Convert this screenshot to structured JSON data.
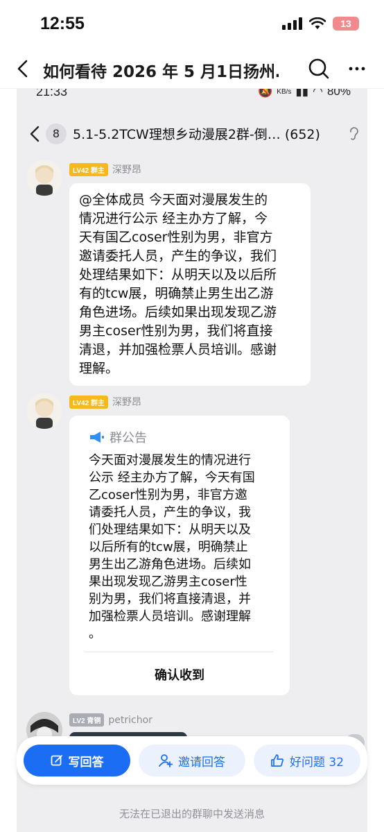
{
  "status_bar": {
    "time": "12:55",
    "battery": "13"
  },
  "nav": {
    "title": "如何看待 2026 年 5 月1日扬州…",
    "back_icon": "chevron-left-icon",
    "search_icon": "search-icon",
    "more_icon": "more-dots-icon"
  },
  "inner_status": {
    "time": "21:33",
    "speed": "KB/s",
    "battery": "80%"
  },
  "chat": {
    "unread": "8",
    "group_name": "5.1-5.2TCW理想乡动漫展2群-倒…",
    "count": "(652)"
  },
  "messages": [
    {
      "level": "LV42 群主",
      "nick": "深野昂",
      "lines": [
        "@全体成员  今天面对漫展发生的",
        "情况进行公示 经主办方了解，今",
        "天有国乙coser性别为男，非官方",
        "邀请委托人员，产生的争议，我们",
        "处理结果如下：从明天以及以后所",
        "有的tcw展，明确禁止男生出乙游",
        "角色进场。后续如果出现发现乙游",
        "男主coser性别为男，我们将直接",
        "清退，并加强检票人员培训。感谢",
        "理解。"
      ]
    },
    {
      "level": "LV42 群主",
      "nick": "深野昂",
      "announcement_title": "群公告",
      "lines": [
        "今天面对漫展发生的情况进行",
        "公示 经主办方了解，今天有国",
        "乙coser性别为男，非官方邀",
        "请委托人员，产生的争议，我",
        "们处理结果如下：从明天以及",
        "以后所有的tcw展，明确禁止",
        "男生出乙游角色进场。后续如",
        "果出现发现乙游男主coser性",
        "别为男，我们将直接清退，并",
        "加强检票人员培训。感谢理解",
        "。"
      ],
      "confirm": "确认收到"
    },
    {
      "level": "LV2 青铜",
      "nick": "petrichor"
    }
  ],
  "actions": {
    "write": "写回答",
    "invite": "邀请回答",
    "good": "好问题 32"
  },
  "footer": "无法在已退出的群聊中发送消息"
}
